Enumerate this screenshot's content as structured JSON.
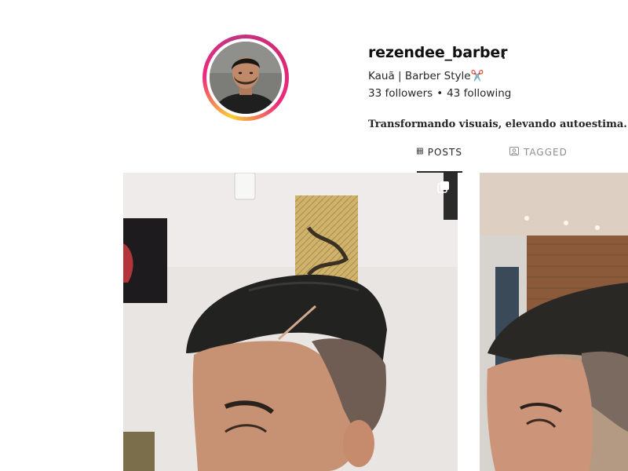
{
  "profile": {
    "username": "rezendee_barber",
    "full_name": "Kauã | Barber Style✂️",
    "followers": "33 followers",
    "separator": "•",
    "following": "43 following",
    "bio": "Transformando visuais, elevando autoestima. Age"
  },
  "tabs": [
    {
      "label": "POSTS",
      "icon": "grid-icon",
      "active": true
    },
    {
      "label": "TAGGED",
      "icon": "tagged-icon",
      "active": false
    }
  ],
  "posts": [
    {
      "name": "post-1",
      "multi_image": true
    },
    {
      "name": "post-2",
      "multi_image": false
    }
  ],
  "colors": {
    "story_ring_start": "#f9ce34",
    "story_ring_mid": "#ee2a7b",
    "story_ring_end": "#c13584",
    "text_primary": "#262626",
    "text_muted": "#8e8e8e"
  }
}
